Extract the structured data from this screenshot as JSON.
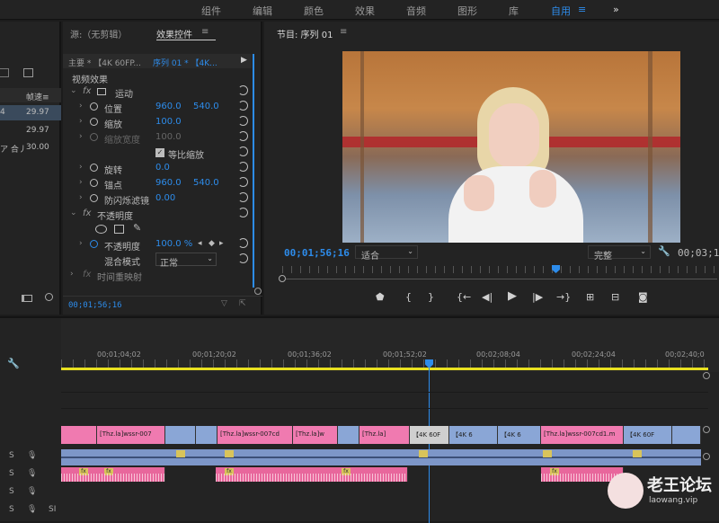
{
  "workspaces": [
    "组件",
    "编辑",
    "颜色",
    "效果",
    "音频",
    "图形",
    "库",
    "自用"
  ],
  "menu_icon": "≡",
  "more": "»",
  "left": {
    "col_header": "帧速≡",
    "rows": [
      {
        "name": "4",
        "rate": "29.97"
      },
      {
        "name": "",
        "rate": "29.97"
      },
      {
        "name": "ア 合丿",
        "rate": "30.00"
      }
    ]
  },
  "fx": {
    "tab_source": "源:（无剪辑）",
    "tab_effects": "效果控件",
    "master": "主要 * 【4K 60FP...",
    "sequence": "序列 01 * 【4K...",
    "video_effects": "视频效果",
    "motion": "运动",
    "position": {
      "label": "位置",
      "x": "960.0",
      "y": "540.0"
    },
    "scale": {
      "label": "缩放",
      "v": "100.0"
    },
    "scale_width": {
      "label": "缩放宽度",
      "v": "100.0"
    },
    "uniform": "等比缩放",
    "rotation": {
      "label": "旋转",
      "v": "0.0"
    },
    "anchor": {
      "label": "锚点",
      "x": "960.0",
      "y": "540.0"
    },
    "antiflicker": {
      "label": "防闪烁滤镜",
      "v": "0.00"
    },
    "opacity_group": "不透明度",
    "opacity": {
      "label": "不透明度",
      "v": "100.0 %"
    },
    "blend": {
      "label": "混合模式",
      "v": "正常"
    },
    "time_remap": "时间重映射",
    "timecode": "00;01;56;16"
  },
  "program": {
    "title": "节目: 序列 01",
    "timecode": "00;01;56;16",
    "fit": "适合",
    "quality": "完整",
    "timecode_right": "00;03;1"
  },
  "timeline": {
    "ticks": [
      "00;01;04;02",
      "00;01;20;02",
      "00;01;36;02",
      "00;01;52;02",
      "00;02;08;04",
      "00;02;24;04",
      "00;02;40;0"
    ],
    "video_clips": [
      {
        "label": "[Thz.la]wssr-007",
        "cls": "pink"
      },
      {
        "label": "[Thz.la]wssr-007cd",
        "cls": "pink"
      },
      {
        "label": "[Thz.la]w",
        "cls": "pink"
      },
      {
        "label": "[Thz.la]",
        "cls": "pink"
      },
      {
        "label": "【4K 60F",
        "cls": "grey"
      },
      {
        "label": "【4K 6",
        "cls": "blue"
      },
      {
        "label": "【4K 6",
        "cls": "blue"
      },
      {
        "label": "[Thz.la]wssr-007cd1.m",
        "cls": "pink"
      },
      {
        "label": "【4K 60F",
        "cls": "blue"
      }
    ],
    "track_s": "S",
    "track_si": "SI",
    "fx_label": "fx"
  },
  "watermark": {
    "cn": "老王论坛",
    "en": "laowang.vip"
  }
}
